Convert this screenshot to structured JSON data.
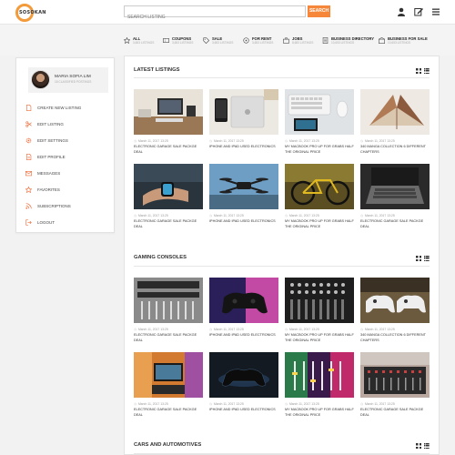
{
  "header": {
    "logo_text": "SOSOKAN",
    "search_placeholder": "SEARCH LISTING",
    "search_button": "SEARCH",
    "icons": [
      "user-icon",
      "edit-icon",
      "menu-icon"
    ]
  },
  "categories": [
    {
      "title": "ALL",
      "sub": "3,653 LISTINGS",
      "icon": "star-icon"
    },
    {
      "title": "COUPONS",
      "sub": "3,653 LISTINGS",
      "icon": "coupon-icon"
    },
    {
      "title": "SALE",
      "sub": "3,653 LISTINGS",
      "icon": "tag-icon"
    },
    {
      "title": "FOR RENT",
      "sub": "3,653 LISTINGS",
      "icon": "key-icon"
    },
    {
      "title": "JOBS",
      "sub": "8,683 LISTINGS",
      "icon": "briefcase-icon"
    },
    {
      "title": "BUSINESS DIRECTORY",
      "sub": "10,653 LISTINGS",
      "icon": "directory-icon"
    },
    {
      "title": "BUSINESS FOR SALE",
      "sub": "10,653 LISTINGS",
      "icon": "business-icon"
    }
  ],
  "profile": {
    "name": "MARIA SOFIA LIM",
    "sub": "18 CLASSIFIED POSTINGS"
  },
  "menu": [
    {
      "label": "CREATE NEW LISTING",
      "icon": "document-icon"
    },
    {
      "label": "EDIT LISTING",
      "icon": "scissors-icon"
    },
    {
      "label": "EDIT SETTINGS",
      "icon": "gear-icon"
    },
    {
      "label": "EDIT PROFILE",
      "icon": "document-edit-icon"
    },
    {
      "label": "MESSAGES",
      "icon": "envelope-icon"
    },
    {
      "label": "FAVORITES",
      "icon": "star-icon"
    },
    {
      "label": "SUBSCRIPTIONS",
      "icon": "rss-icon"
    },
    {
      "label": "LOGOUT",
      "icon": "logout-icon"
    }
  ],
  "sections": [
    {
      "title": "LATEST LISTINGS",
      "cards": [
        {
          "date": "March 11, 2017 13:25",
          "title": "ELECTRONIC GARAGE SALE PACKGE DEAL",
          "image": "desk-setup"
        },
        {
          "date": "March 11, 2017 13:25",
          "title": "IPHONE AND IPAD USED ELECTRONICS",
          "image": "iphone-ipad"
        },
        {
          "date": "March 11, 2017 13:25",
          "title": "MY MACBOOK PRO UP FOR GRABS HALF THE ORIGINAL PRICE",
          "image": "keyboard-mouse"
        },
        {
          "date": "March 11, 2017 13:25",
          "title": "340 MANGA COLLECTION 6 DIFFERENT CHAPTERS",
          "image": "book"
        },
        {
          "date": "March 11, 2017 13:25",
          "title": "ELECTRONIC GARAGE SALE PACKGE DEAL",
          "image": "watch"
        },
        {
          "date": "March 11, 2017 13:25",
          "title": "IPHONE AND IPAD USED ELECTRONICS",
          "image": "drone"
        },
        {
          "date": "March 11, 2017 13:25",
          "title": "MY MACBOOK PRO UP FOR GRABS HALF THE ORIGINAL PRICE",
          "image": "bike"
        },
        {
          "date": "March 11, 2017 13:25",
          "title": "ELECTRONIC GARAGE SALE PACKGE DEAL",
          "image": "laptop"
        }
      ]
    },
    {
      "title": "GAMING CONSOLES",
      "cards": [
        {
          "date": "March 11, 2017 13:25",
          "title": "ELECTRONIC GARAGE SALE PACKGE DEAL",
          "image": "mixer"
        },
        {
          "date": "March 11, 2017 13:25",
          "title": "IPHONE AND IPAD USED ELECTRONICS",
          "image": "gamepad"
        },
        {
          "date": "March 11, 2017 13:25",
          "title": "MY MACBOOK PRO UP FOR GRABS HALF THE ORIGINAL PRICE",
          "image": "mixer-bw"
        },
        {
          "date": "March 11, 2017 13:25",
          "title": "340 MANGA COLLECTION 6 DIFFERENT CHAPTERS",
          "image": "xbox-controllers"
        },
        {
          "date": "March 11, 2017 13:25",
          "title": "ELECTRONIC GARAGE SALE PACKGE DEAL",
          "image": "tv-room"
        },
        {
          "date": "March 11, 2017 13:25",
          "title": "IPHONE AND IPAD USED ELECTRONICS",
          "image": "dark-controller"
        },
        {
          "date": "March 11, 2017 13:25",
          "title": "MY MACBOOK PRO UP FOR GRABS HALF THE ORIGINAL PRICE",
          "image": "colorful-mixer"
        },
        {
          "date": "March 11, 2017 13:25",
          "title": "ELECTRONIC GARAGE SALE PACKGE DEAL",
          "image": "soundboard"
        }
      ]
    },
    {
      "title": "CARS AND AUTOMOTIVES",
      "cards": []
    }
  ]
}
